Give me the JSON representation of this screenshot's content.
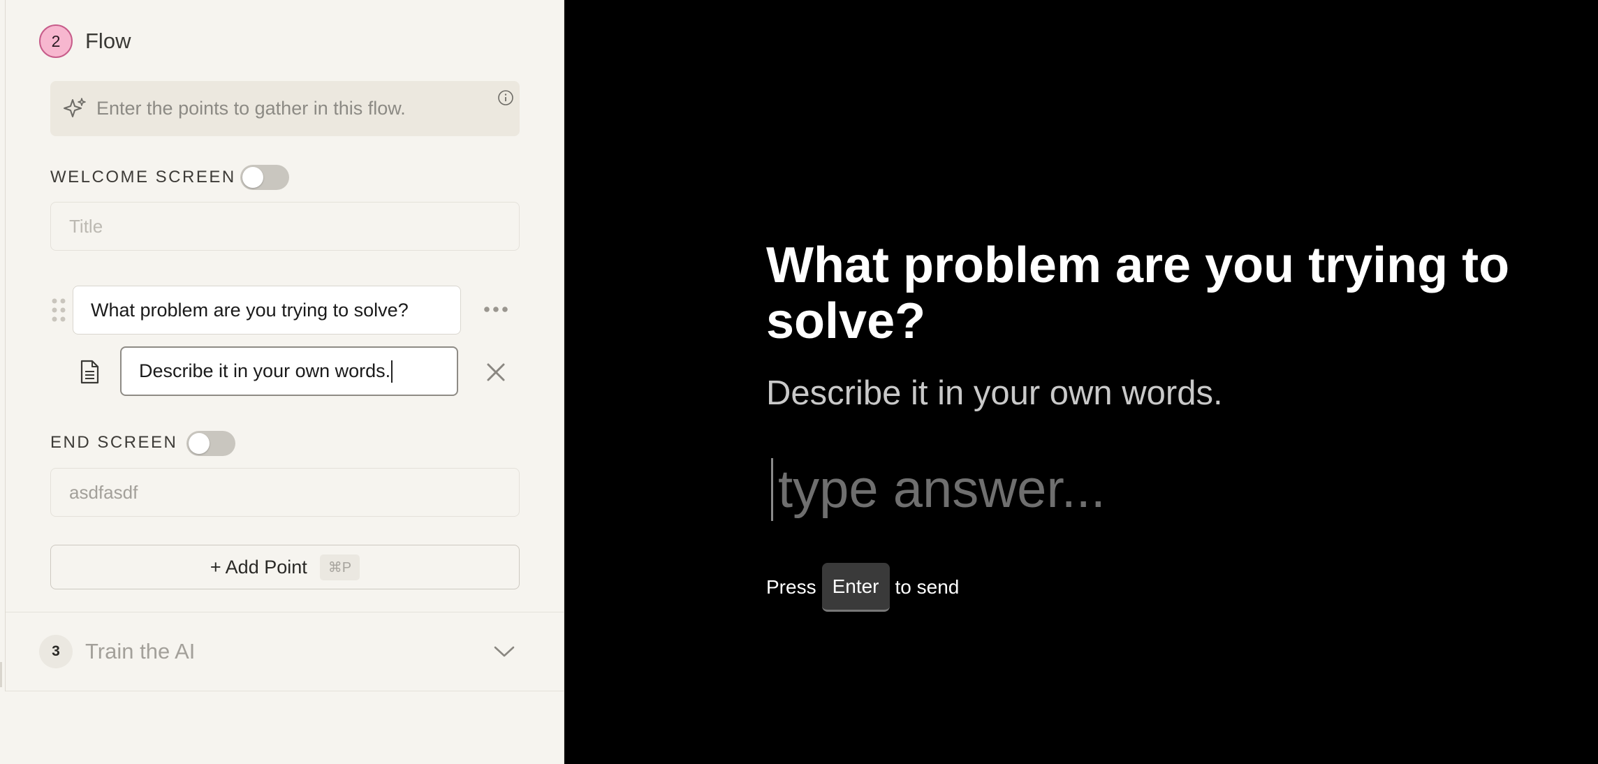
{
  "flow_step": {
    "number": "2",
    "title": "Flow"
  },
  "hint": {
    "text": "Enter the points to gather in this flow."
  },
  "welcome_screen": {
    "label": "WELCOME SCREEN",
    "title_placeholder": "Title",
    "enabled": false
  },
  "question": {
    "text": "What problem are you trying to solve?"
  },
  "description": {
    "text": "Describe it in your own words."
  },
  "end_screen": {
    "label": "END SCREEN",
    "value": "asdfasdf",
    "enabled": false
  },
  "add_point": {
    "label": "+ Add Point",
    "shortcut": "⌘P"
  },
  "train_step": {
    "number": "3",
    "title": "Train the AI"
  },
  "preview": {
    "question": "What problem are you trying to solve?",
    "description": "Describe it in your own words.",
    "answer_placeholder": "type answer...",
    "press_label": "Press",
    "key_label": "Enter",
    "send_label": "to send"
  },
  "colors": {
    "step_active_bg": "#f7b7cf",
    "step_active_border": "#c75c8a",
    "preview_bg": "#000000",
    "panel_bg": "#f6f4ef"
  }
}
